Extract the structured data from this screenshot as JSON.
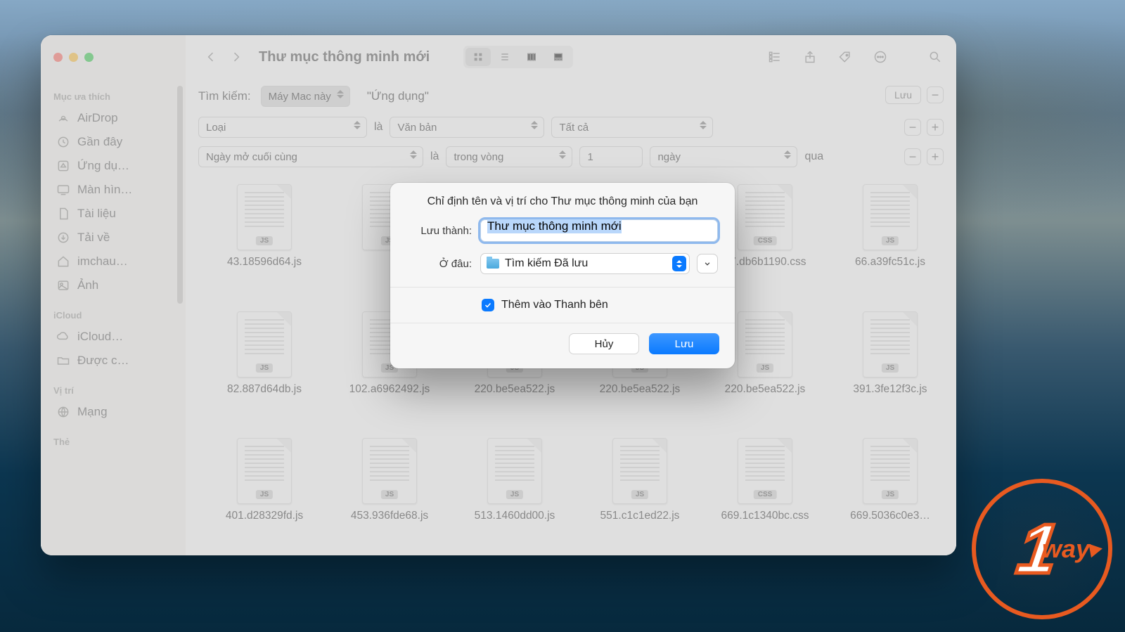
{
  "window": {
    "title": "Thư mục thông minh mới"
  },
  "search": {
    "label": "Tìm kiếm:",
    "scopes": {
      "a": "Máy Mac này",
      "b": "\"Ứng dụng\""
    },
    "save_label": "Lưu",
    "criteria": [
      {
        "attr": "Loại",
        "is_label": "là",
        "match": "Văn bản",
        "cond": "Tất cả"
      },
      {
        "attr": "Ngày mở cuối cùng",
        "is_label": "là",
        "match": "trong vòng",
        "value": "1",
        "unit": "ngày",
        "ago": "qua"
      }
    ]
  },
  "sidebar": {
    "sections": {
      "fav": "Mục ưa thích",
      "icloud": "iCloud",
      "loc": "Vị trí",
      "tags": "Thẻ"
    },
    "fav_items": [
      "AirDrop",
      "Gần đây",
      "Ứng dụ…",
      "Màn hìn…",
      "Tài liệu",
      "Tải về",
      "imchau…",
      "Ảnh"
    ],
    "icloud_items": [
      "iCloud…",
      "Được c…"
    ],
    "loc_items": [
      "Mạng"
    ]
  },
  "files": {
    "row1": [
      "43.18596d64.js",
      "",
      "",
      "",
      "47.db6b1190.css",
      "66.a39fc51c.js"
    ],
    "row2": [
      "82.887d64db.js",
      "102.a6962492.js",
      "220.be5ea522.js",
      "220.be5ea522.js",
      "220.be5ea522.js",
      "391.3fe12f3c.js"
    ],
    "row3": [
      "401.d28329fd.js",
      "453.936fde68.js",
      "513.1460dd00.js",
      "551.c1c1ed22.js",
      "669.1c1340bc.css",
      "669.5036c0e3…"
    ],
    "badge_js": "JS",
    "badge_css": "CSS"
  },
  "sheet": {
    "title": "Chỉ định tên và vị trí cho Thư mục thông minh của bạn",
    "name_label": "Lưu thành:",
    "name_value": "Thư mục thông minh mới",
    "where_label": "Ở đâu:",
    "where_value": "Tìm kiếm Đã lưu",
    "sidebar_checkbox": "Thêm vào Thanh bên",
    "cancel": "Hủy",
    "save": "Lưu"
  },
  "watermark": {
    "num": "1",
    "text": "way"
  }
}
